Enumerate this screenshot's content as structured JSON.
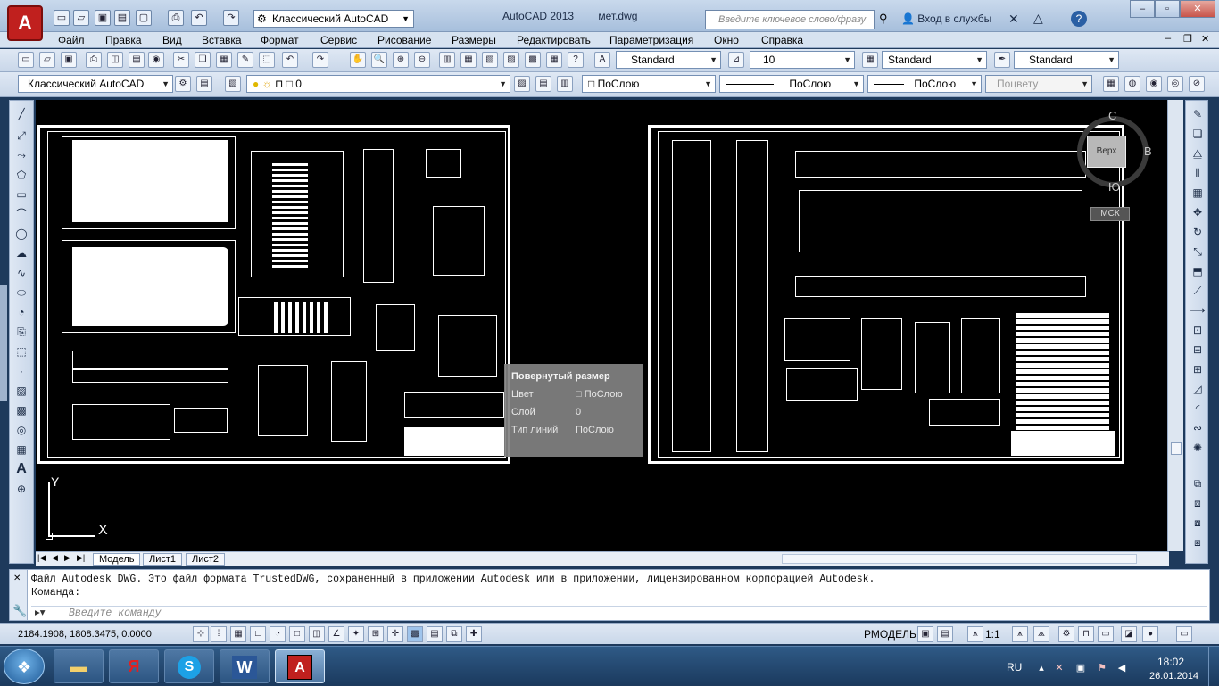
{
  "titlebar": {
    "logo": "A",
    "workspace": "Классический AutoCAD",
    "app_name": "AutoCAD 2013",
    "file_name": "мет.dwg",
    "search_placeholder": "Введите ключевое слово/фразу",
    "signin_label": "Вход в службы"
  },
  "menu": [
    "Файл",
    "Правка",
    "Вид",
    "Вставка",
    "Формат",
    "Сервис",
    "Рисование",
    "Размеры",
    "Редактировать",
    "Параметризация",
    "Окно",
    "Справка"
  ],
  "styles_toolbar": {
    "text_style": "Standard",
    "dim_scale": "10",
    "dim_style": "Standard",
    "table_style": "Standard"
  },
  "layers_toolbar": {
    "workspace": "Классический AutoCAD",
    "layer": "0",
    "color": "ПоСлою",
    "linetype": "ПоСлою",
    "lineweight": "ПоСлою",
    "plotstyle": "Поцвету"
  },
  "tooltip": {
    "title": "Повернутый размер",
    "rows": [
      {
        "label": "Цвет",
        "value": "ПоСлою"
      },
      {
        "label": "Слой",
        "value": "0"
      },
      {
        "label": "Тип линий",
        "value": "ПоСлою"
      }
    ]
  },
  "viewcube": {
    "face": "Верх",
    "north": "С",
    "south": "Ю",
    "east": "В",
    "ucs": "МСК"
  },
  "ucs_icon": {
    "x": "X",
    "y": "Y"
  },
  "tabs": [
    "Модель",
    "Лист1",
    "Лист2"
  ],
  "command": {
    "history_1": "Файл Autodesk DWG. Это файл формата TrustedDWG, сохраненный в приложении Autodesk или в приложении, лицензированном корпорацией Autodesk.",
    "history_2": "Команда:",
    "input_placeholder": "Введите команду"
  },
  "status": {
    "coords": "2184.1908, 1808.3475, 0.0000",
    "space": "РМОДЕЛЬ",
    "scale": "1:1"
  },
  "taskbar": {
    "apps": [
      "Проводник",
      "Я",
      "Skype",
      "W",
      "AutoCAD"
    ],
    "lang": "RU",
    "time": "18:02",
    "date": "26.01.2014"
  }
}
